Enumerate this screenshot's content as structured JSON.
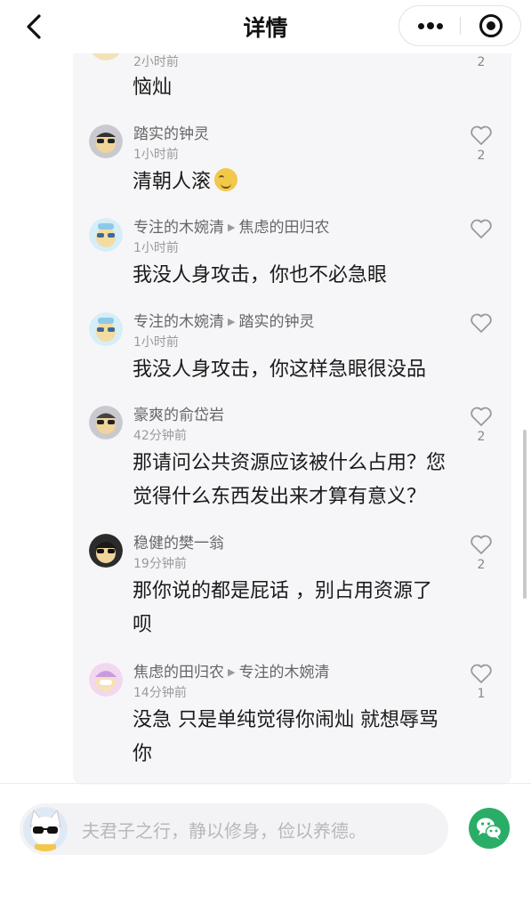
{
  "header": {
    "title": "详情",
    "back_icon": "chevron-left-icon",
    "more_icon": "more-dots-icon",
    "close_icon": "target-close-icon"
  },
  "top_partial": {
    "time": "2小时前",
    "content": "恼灿",
    "likes": "2"
  },
  "replies": [
    {
      "author": "踏实的钟灵",
      "reply_to": "",
      "time": "1小时前",
      "content": "清朝人滚",
      "likes": "2",
      "emoji": "grin-face-emoji"
    },
    {
      "author": "专注的木婉清",
      "reply_to": "焦虑的田归农",
      "time": "1小时前",
      "content": "我没人身攻击，你也不必急眼",
      "likes": ""
    },
    {
      "author": "专注的木婉清",
      "reply_to": "踏实的钟灵",
      "time": "1小时前",
      "content": "我没人身攻击，你这样急眼很没品",
      "likes": ""
    },
    {
      "author": "豪爽的俞岱岩",
      "reply_to": "",
      "time": "42分钟前",
      "content_lines": [
        "那请问公共资源应该被什么占用？您",
        "觉得什么东西发出来才算有意义？"
      ],
      "likes": "2"
    },
    {
      "author": "稳健的樊一翁",
      "reply_to": "",
      "time": "19分钟前",
      "content_lines": [
        "那你说的都是屁话 ，别占用资源了",
        "呗"
      ],
      "likes": "2"
    },
    {
      "author": "焦虑的田归农",
      "reply_to": "专注的木婉清",
      "time": "14分钟前",
      "content_lines": [
        "没急 只是单纯觉得你闹灿 就想辱骂",
        "你"
      ],
      "likes": "1"
    }
  ],
  "input": {
    "placeholder": "夫君子之行，静以修身，俭以养德。"
  },
  "colors": {
    "panel_bg": "#f6f6f8",
    "wechat_green": "#2aae67",
    "name_gray": "#666666",
    "time_gray": "#9a9a9a"
  }
}
